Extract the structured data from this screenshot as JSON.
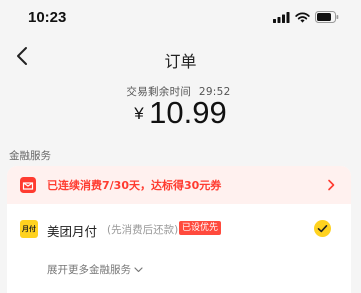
{
  "status_bar": {
    "time": "10:23",
    "icons": [
      "signal-icon",
      "wifi-icon",
      "battery-icon"
    ]
  },
  "nav": {
    "title": "订单",
    "back_icon": "chevron-left-icon"
  },
  "order": {
    "countdown_label": "交易剩余时间",
    "countdown_value": "29:52",
    "currency": "¥",
    "amount": "10.99"
  },
  "finance": {
    "section_label": "金融服务",
    "promo": {
      "text": "已连续消费7/30天，达标得30元券",
      "icon": "gift-icon",
      "color": "#ff3b30"
    },
    "payment": {
      "logo_text": "月付",
      "name": "美团月付",
      "subtitle": "(先消费后还款)",
      "badge": "已设优先",
      "selected": true
    },
    "more_label": "展开更多金融服务"
  },
  "colors": {
    "accent_yellow": "#ffd21f",
    "alert_red": "#ff3b30",
    "background": "#f5f5f5"
  }
}
